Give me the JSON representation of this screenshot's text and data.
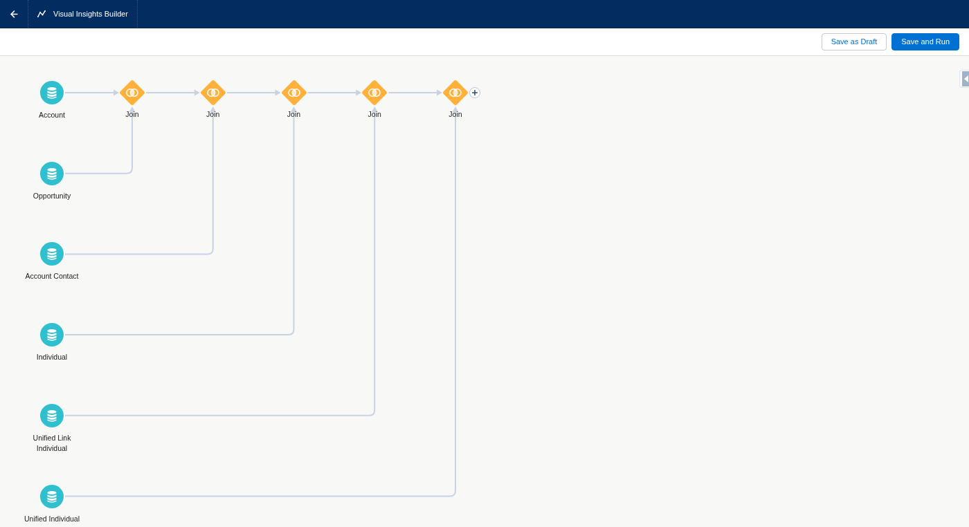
{
  "header": {
    "tab": {
      "title": "Visual Insights Builder"
    }
  },
  "toolbar": {
    "buttons": [
      {
        "label": "Save as Draft",
        "kind": "secondary"
      },
      {
        "label": "Save and Run",
        "kind": "primary"
      }
    ]
  },
  "canvas": {
    "sources": [
      {
        "label": "Account"
      },
      {
        "label": "Opportunity"
      },
      {
        "label": "Account Contact"
      },
      {
        "label": "Individual"
      },
      {
        "label": "Unified Link Individual"
      },
      {
        "label": "Unified Individual"
      }
    ],
    "joins": [
      {
        "label": "Join"
      },
      {
        "label": "Join"
      },
      {
        "label": "Join"
      },
      {
        "label": "Join"
      },
      {
        "label": "Join"
      }
    ]
  }
}
